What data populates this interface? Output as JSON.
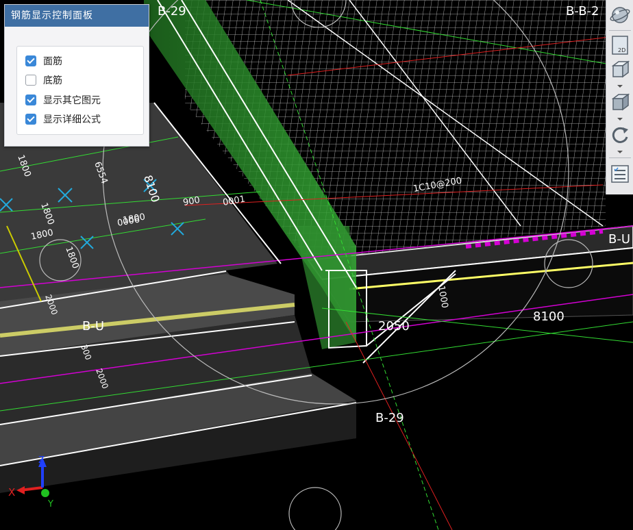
{
  "panel": {
    "title": "钢筋显示控制面板",
    "options": [
      {
        "label": "面筋",
        "checked": true
      },
      {
        "label": "底筋",
        "checked": false
      },
      {
        "label": "显示其它图元",
        "checked": true
      },
      {
        "label": "显示详细公式",
        "checked": true
      }
    ]
  },
  "viewport": {
    "grid_labels": {
      "top_left": "B-29",
      "top_right": "B-B-2",
      "right": "B-U",
      "left": "B-U",
      "bottom": "B-29"
    },
    "dimensions": {
      "d_8100_top": "8100",
      "d_8100_right": "8100",
      "d_2050": "2050",
      "d_1000": "1000",
      "d_1800_a": "1800",
      "d_1800_b": "1800",
      "d_1800_c": "1800",
      "d_1800_d": "1800",
      "d_1800_e": "1800",
      "d_900": "900",
      "d_0001": "0001",
      "d_0006": "0006",
      "d_6554": "6554",
      "d_2000_a": "2000",
      "d_2000_b": "2000",
      "d_300": "300",
      "rebar": "1C10@200"
    },
    "axes": {
      "x": "X",
      "y": "Y",
      "z": "Z"
    }
  },
  "toolbar": {
    "mode_2d": "2D",
    "icons": [
      "orbit-icon",
      "view-2d-icon",
      "view-3d-box-icon",
      "cube-icon",
      "rotate-icon",
      "layer-list-icon"
    ]
  },
  "colors": {
    "panel_header": "#3f6fa3",
    "checkbox_on": "#3a88d8",
    "wall_green": "#38a838",
    "magenta": "#d400d4",
    "axis_red": "#e02020",
    "axis_blue": "#2040ff",
    "axis_green": "#20c020"
  }
}
